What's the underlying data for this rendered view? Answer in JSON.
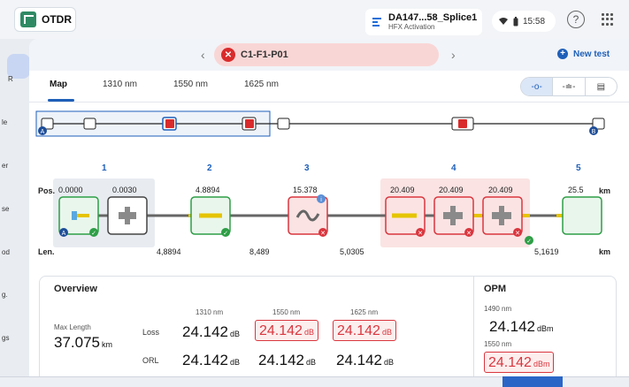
{
  "app": {
    "title": "OTDR"
  },
  "job": {
    "title": "DA147...58_Splice1",
    "subtitle": "HFX Activation"
  },
  "status": {
    "time": "15:58"
  },
  "rail": {
    "items": [
      "R",
      "le",
      "er",
      "se",
      "od",
      "g.",
      "gs"
    ]
  },
  "fiber": {
    "name": "C1-F1-P01"
  },
  "new_test_label": "New test",
  "tabs": [
    "Map",
    "1310 nm",
    "1550 nm",
    "1625 nm"
  ],
  "view_icons": [
    "trace-view-icon",
    "link-view-icon",
    "table-view-icon"
  ],
  "map": {
    "pos_label": "Pos.",
    "len_label": "Len.",
    "unit": "km",
    "event_numbers": [
      "1",
      "2",
      "3",
      "4",
      "5"
    ],
    "positions": [
      "0.0000",
      "0.0030",
      "4.8894",
      "15.378",
      "20.409",
      "20.409",
      "20.409",
      "25.5"
    ],
    "lengths": [
      "4,8894",
      "8,489",
      "5,0305",
      "5,1619"
    ],
    "overview_endpoints": [
      "A",
      "B"
    ]
  },
  "overview": {
    "title": "Overview",
    "max_length_label": "Max Length",
    "max_length_value": "37.075",
    "max_length_unit": "km",
    "wavelengths": [
      "1310 nm",
      "1550 nm",
      "1625 nm"
    ],
    "rows": [
      {
        "label": "Loss",
        "values": [
          "24.142",
          "24.142",
          "24.142"
        ],
        "unit": "dB"
      },
      {
        "label": "ORL",
        "values": [
          "24.142",
          "24.142",
          "24.142"
        ],
        "unit": "dB"
      }
    ]
  },
  "opm": {
    "title": "OPM",
    "items": [
      {
        "wavelength": "1490 nm",
        "value": "24.142",
        "unit": "dBm"
      },
      {
        "wavelength": "1550 nm",
        "value": "24.142",
        "unit": "dBm"
      }
    ]
  },
  "colors": {
    "accent": "#1e5fb9",
    "pass": "#2e9e46",
    "fail": "#d9363e",
    "brand": "#2f8a64"
  }
}
